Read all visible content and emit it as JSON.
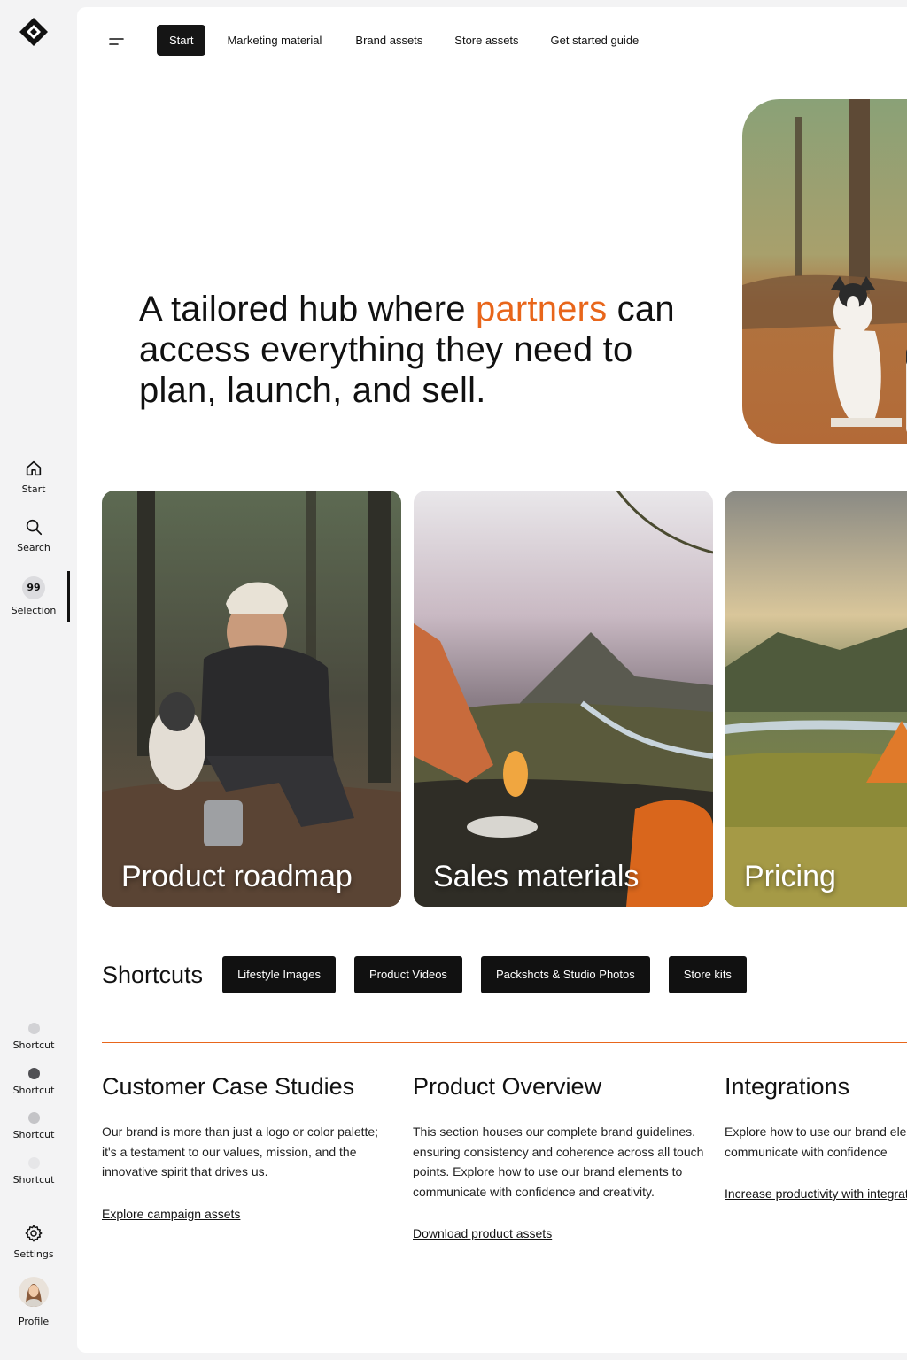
{
  "rail": {
    "items": [
      {
        "label": "Start",
        "icon": "home-icon"
      },
      {
        "label": "Search",
        "icon": "search-icon"
      },
      {
        "label": "Selection",
        "icon": "selection-badge",
        "badge": "99"
      }
    ],
    "shortcuts": [
      {
        "label": "Shortcut",
        "color": "#d2d2d5"
      },
      {
        "label": "Shortcut",
        "color": "#505054"
      },
      {
        "label": "Shortcut",
        "color": "#c4c4c7"
      },
      {
        "label": "Shortcut",
        "color": "#e6e6e8"
      }
    ],
    "settings_label": "Settings",
    "profile_label": "Profile"
  },
  "topnav": {
    "tabs": [
      "Start",
      "Marketing material",
      "Brand assets",
      "Store assets",
      "Get started guide"
    ],
    "active_index": 0
  },
  "hero": {
    "title_before": "A tailored hub where ",
    "title_accent": "partners",
    "title_after": " can access everything they need to plan, launch, and sell.",
    "accent_color": "#e8661b"
  },
  "cards": [
    {
      "label": "Product roadmap"
    },
    {
      "label": "Sales materials"
    },
    {
      "label": "Pricing"
    }
  ],
  "shortcuts": {
    "title": "Shortcuts",
    "chips": [
      "Lifestyle Images",
      "Product Videos",
      "Packshots & Studio Photos",
      "Store kits"
    ]
  },
  "columns": [
    {
      "title": "Customer Case Studies",
      "body": "Our brand is more than just a logo or color palette; it's a testament to our values, mission, and the innovative spirit that drives us.",
      "link": "Explore campaign assets"
    },
    {
      "title": "Product Overview",
      "body": "This section houses our complete brand guidelines. ensuring consistency and coherence across all touch points. Explore how to use our brand elements to communicate with confidence and creativity.",
      "link": "Download product assets"
    },
    {
      "title": "Integrations",
      "body": "Explore how to use our brand elements to communicate with confidence",
      "link": "Increase productivity with integrations"
    }
  ]
}
